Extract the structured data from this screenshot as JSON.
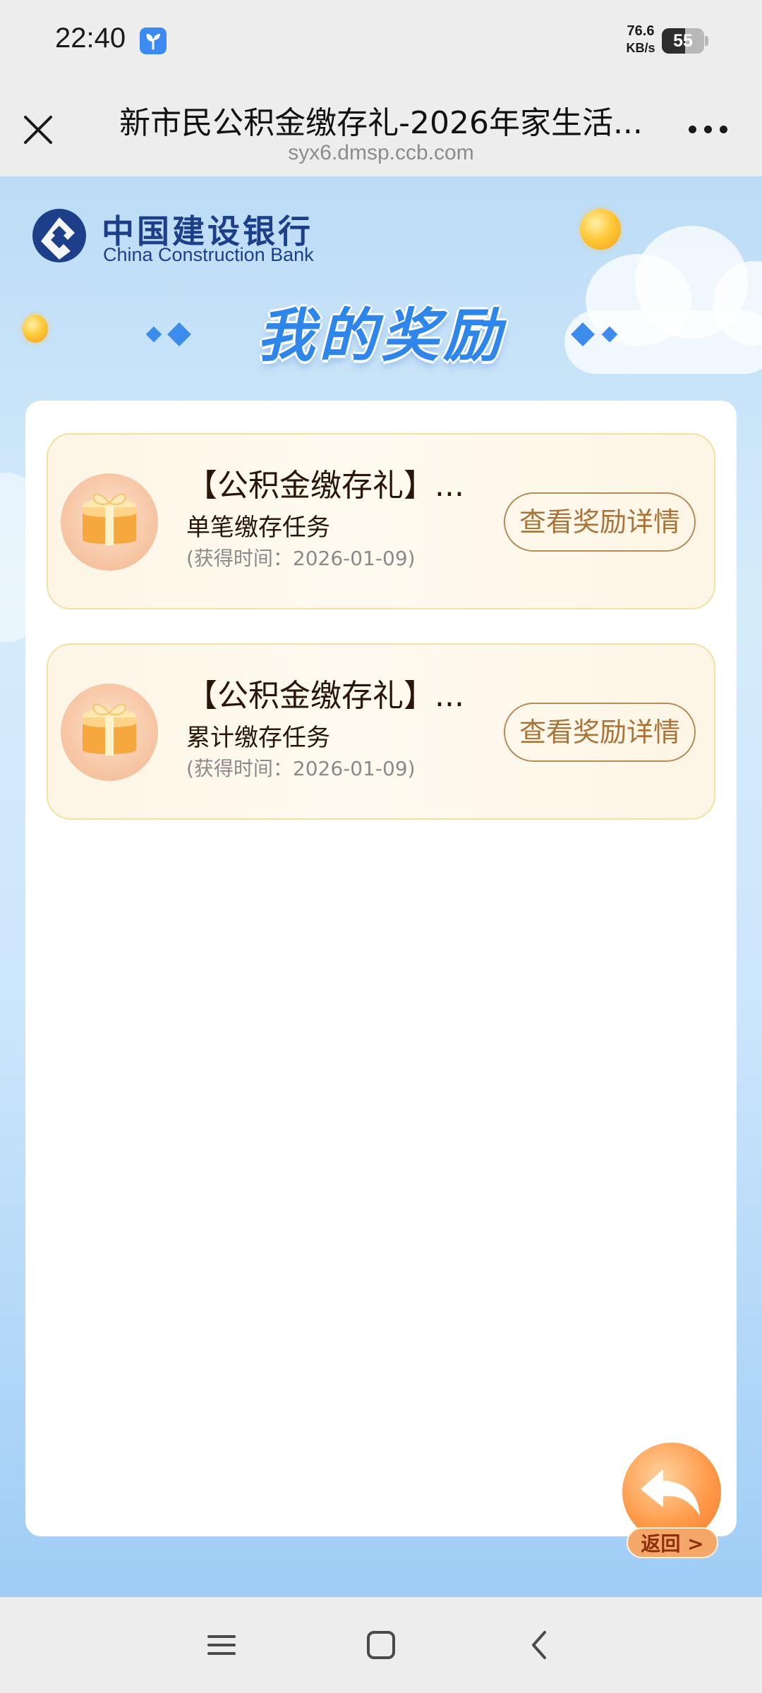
{
  "status_bar": {
    "time": "22:40",
    "app_icon": "leaf-app-icon",
    "net_speed_value": "76.6",
    "net_speed_unit": "KB/s",
    "battery_level": "55",
    "battery_fraction": 0.55
  },
  "browser": {
    "close_icon": "close-icon",
    "title": "新市民公积金缴存礼-2026年家生活...",
    "url": "syx6.dmsp.ccb.com",
    "more_icon": "more-icon"
  },
  "brand": {
    "name_cn": "中国建设银行",
    "name_en": "China Construction Bank",
    "color": "#1d3f8a"
  },
  "page": {
    "title": "我的奖励",
    "accent_color": "#2f86ea"
  },
  "rewards": [
    {
      "title": "【公积金缴存礼】...",
      "subtitle": "单笔缴存任务",
      "time": "(获得时间：2026-01-09)",
      "button_label": "查看奖励详情",
      "icon": "gift-box-icon"
    },
    {
      "title": "【公积金缴存礼】...",
      "subtitle": "累计缴存任务",
      "time": "(获得时间：2026-01-09)",
      "button_label": "查看奖励详情",
      "icon": "gift-box-icon"
    }
  ],
  "back_button": {
    "label": "返回 >",
    "icon": "return-arrow-icon"
  },
  "nav_bar": {
    "menu_icon": "menu-icon",
    "home_icon": "home-icon",
    "back_icon": "back-icon"
  }
}
